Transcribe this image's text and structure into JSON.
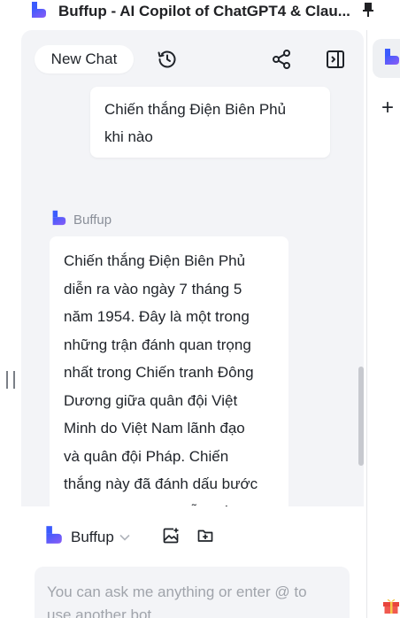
{
  "window": {
    "title": "Buffup - AI Copilot of ChatGPT4 & Clau...",
    "app_icon": "buffup-logo-icon",
    "pin_icon": "pin-icon"
  },
  "header": {
    "new_chat_label": "New Chat",
    "history_icon": "history-icon",
    "share_icon": "share-icon",
    "panel_toggle_icon": "sidebar-toggle-icon"
  },
  "conversation": {
    "user_message": {
      "lines": [
        "Chiến thắng Điện Biên Phủ",
        "khi nào"
      ]
    },
    "bot_name": "Buffup",
    "bot_message": {
      "lines": [
        "Chiến thắng Điện Biên Phủ",
        "diễn ra vào ngày 7 tháng 5",
        "năm 1954. Đây là một trong",
        "những trận đánh quan trọng",
        "nhất trong Chiến tranh Đông",
        "Dương giữa quân đội Việt",
        "Minh do Việt Nam lãnh đạo",
        "và quân đội Pháp. Chiến",
        "thắng này đã đánh dấu bước",
        "ngoặt quan trọng dẫn đến"
      ]
    }
  },
  "composer": {
    "bot_selector_label": "Buffup",
    "image_icon": "add-image-icon",
    "folder_icon": "add-folder-icon",
    "placeholder_lines": [
      "You can ask me anything or enter @  to",
      "use another bot"
    ]
  },
  "rail": {
    "new_icon": "plus-icon",
    "gift_icon": "gift-icon"
  },
  "colors": {
    "brand_blue": "#3b5bfd",
    "brand_purple": "#8b5cf6",
    "panel_bg": "#f3f4f7",
    "text": "#1f2329",
    "muted": "#8a8f99"
  }
}
